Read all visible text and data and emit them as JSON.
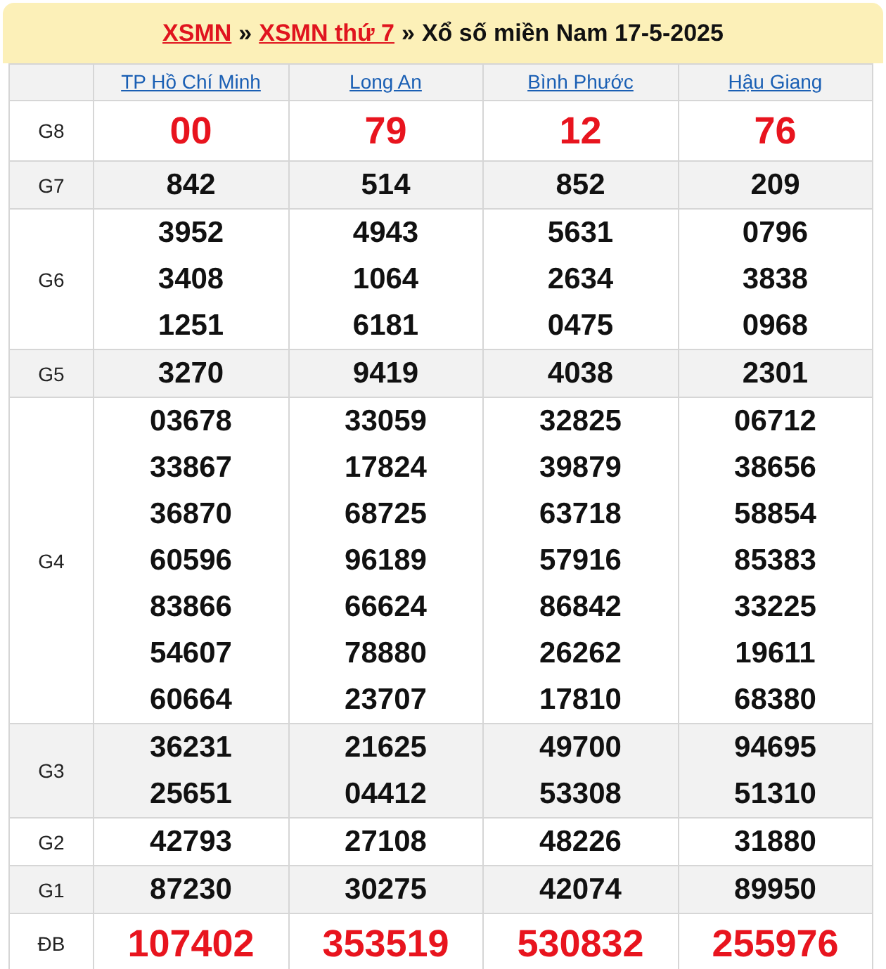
{
  "breadcrumb": [
    {
      "text": "XSMN",
      "link": true
    },
    {
      "text": "»",
      "link": false
    },
    {
      "text": "XSMN thứ 7",
      "link": true
    },
    {
      "text": "»",
      "link": false
    },
    {
      "text": "Xổ số miền Nam 17-5-2025",
      "link": false
    }
  ],
  "provinces": [
    "TP Hồ Chí Minh",
    "Long An",
    "Bình Phước",
    "Hậu Giang"
  ],
  "rows": [
    {
      "label": "G8",
      "kind": "highlight",
      "shaded": false,
      "numbers": [
        [
          "00"
        ],
        [
          "79"
        ],
        [
          "12"
        ],
        [
          "76"
        ]
      ]
    },
    {
      "label": "G7",
      "kind": "normal",
      "shaded": true,
      "numbers": [
        [
          "842"
        ],
        [
          "514"
        ],
        [
          "852"
        ],
        [
          "209"
        ]
      ]
    },
    {
      "label": "G6",
      "kind": "normal",
      "shaded": false,
      "numbers": [
        [
          "3952",
          "3408",
          "1251"
        ],
        [
          "4943",
          "1064",
          "6181"
        ],
        [
          "5631",
          "2634",
          "0475"
        ],
        [
          "0796",
          "3838",
          "0968"
        ]
      ]
    },
    {
      "label": "G5",
      "kind": "normal",
      "shaded": true,
      "numbers": [
        [
          "3270"
        ],
        [
          "9419"
        ],
        [
          "4038"
        ],
        [
          "2301"
        ]
      ]
    },
    {
      "label": "G4",
      "kind": "normal",
      "shaded": false,
      "numbers": [
        [
          "03678",
          "33867",
          "36870",
          "60596",
          "83866",
          "54607",
          "60664"
        ],
        [
          "33059",
          "17824",
          "68725",
          "96189",
          "66624",
          "78880",
          "23707"
        ],
        [
          "32825",
          "39879",
          "63718",
          "57916",
          "86842",
          "26262",
          "17810"
        ],
        [
          "06712",
          "38656",
          "58854",
          "85383",
          "33225",
          "19611",
          "68380"
        ]
      ]
    },
    {
      "label": "G3",
      "kind": "normal",
      "shaded": true,
      "numbers": [
        [
          "36231",
          "25651"
        ],
        [
          "21625",
          "04412"
        ],
        [
          "49700",
          "53308"
        ],
        [
          "94695",
          "51310"
        ]
      ]
    },
    {
      "label": "G2",
      "kind": "normal",
      "shaded": false,
      "numbers": [
        [
          "42793"
        ],
        [
          "27108"
        ],
        [
          "48226"
        ],
        [
          "31880"
        ]
      ]
    },
    {
      "label": "G1",
      "kind": "normal",
      "shaded": true,
      "numbers": [
        [
          "87230"
        ],
        [
          "30275"
        ],
        [
          "42074"
        ],
        [
          "89950"
        ]
      ]
    },
    {
      "label": "ĐB",
      "kind": "highlight",
      "shaded": false,
      "numbers": [
        [
          "107402"
        ],
        [
          "353519"
        ],
        [
          "530832"
        ],
        [
          "255976"
        ]
      ]
    }
  ]
}
